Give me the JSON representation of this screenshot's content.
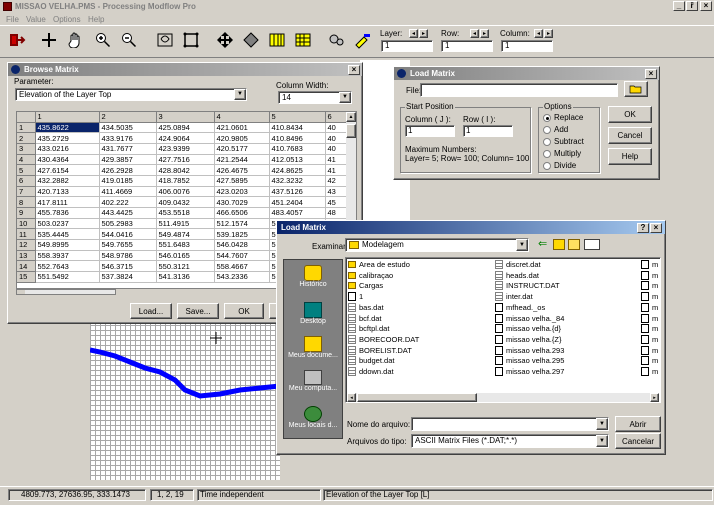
{
  "app": {
    "title": "MISSAO VELHA.PMS - Processing Modflow Pro",
    "menu": [
      "File",
      "Value",
      "Options",
      "Help"
    ],
    "window_buttons": [
      "_",
      "ř",
      "×"
    ]
  },
  "toolbar": {
    "layer_label": "Layer:",
    "row_label": "Row:",
    "column_label": "Column:",
    "layer_value": "1",
    "row_value": "1",
    "column_value": "1"
  },
  "browse": {
    "title": "Browse Matrix",
    "parameter_label": "Parameter:",
    "parameter_value": "Elevation of the Layer Top",
    "column_width_label": "Column Width:",
    "column_width_value": "14",
    "columns": [
      "",
      "1",
      "2",
      "3",
      "4",
      "5",
      "6"
    ],
    "rows": [
      [
        "1",
        "435.8622",
        "434.5035",
        "425.0894",
        "421.0601",
        "410.8434",
        "40"
      ],
      [
        "2",
        "435.2729",
        "433.9176",
        "424.9064",
        "420.9805",
        "410.8496",
        "40"
      ],
      [
        "3",
        "433.0216",
        "431.7677",
        "423.9399",
        "420.5177",
        "410.7683",
        "40"
      ],
      [
        "4",
        "430.4364",
        "429.3857",
        "427.7516",
        "421.2544",
        "412.0513",
        "41"
      ],
      [
        "5",
        "427.6154",
        "426.2928",
        "428.8042",
        "426.4675",
        "424.8625",
        "41"
      ],
      [
        "6",
        "432.2882",
        "419.0185",
        "418.7852",
        "427.5895",
        "432.3232",
        "42"
      ],
      [
        "7",
        "420.7133",
        "411.4669",
        "406.0076",
        "423.0203",
        "437.5126",
        "43"
      ],
      [
        "8",
        "417.8111",
        "402.222",
        "409.0432",
        "430.7029",
        "451.2404",
        "45"
      ],
      [
        "9",
        "455.7836",
        "443.4425",
        "453.5518",
        "466.6506",
        "483.4057",
        "48"
      ],
      [
        "10",
        "503.0237",
        "505.2983",
        "511.4915",
        "512.1574",
        "5",
        ""
      ],
      [
        "11",
        "535.4445",
        "544.0416",
        "549.4874",
        "539.1825",
        "5",
        ""
      ],
      [
        "12",
        "549.8995",
        "549.7655",
        "551.6483",
        "546.0428",
        "5",
        ""
      ],
      [
        "13",
        "558.3937",
        "548.9786",
        "546.0165",
        "544.7607",
        "5",
        ""
      ],
      [
        "14",
        "552.7643",
        "546.3715",
        "550.3121",
        "558.4667",
        "5",
        ""
      ],
      [
        "15",
        "551.5492",
        "537.3824",
        "541.3136",
        "543.2336",
        "5",
        ""
      ]
    ],
    "buttons": [
      "Load...",
      "Save...",
      "OK"
    ]
  },
  "load_small": {
    "title": "Load Matrix",
    "file_label": "File:",
    "start_position_label": "Start Position",
    "column_label": "Column ( J ):",
    "row_label": "Row ( I ):",
    "column_value": "1",
    "row_value": "1",
    "max_numbers_label": "Maximum Numbers:",
    "max_numbers_value": "Layer= 5; Row= 100; Column= 100",
    "options_label": "Options",
    "options": [
      "Replace",
      "Add",
      "Subtract",
      "Multiply",
      "Divide"
    ],
    "selected_option": "Replace",
    "buttons": [
      "OK",
      "Cancel",
      "Help"
    ]
  },
  "file_dialog": {
    "title": "Load Matrix",
    "title_buttons": [
      "?",
      "×"
    ],
    "look_in_label": "Examinar:",
    "look_in_value": "Modelagem",
    "places": [
      "Histórico",
      "Desktop",
      "Meus docume...",
      "Meu computa...",
      "Meus locais d..."
    ],
    "files_col1": [
      {
        "name": "Area de estudo",
        "icon": "folder-icon"
      },
      {
        "name": "calibraçao",
        "icon": "folder-icon"
      },
      {
        "name": "Cargas",
        "icon": "folder-icon"
      },
      {
        "name": "1",
        "icon": "doc-icon"
      },
      {
        "name": "bas.dat",
        "icon": "dat-icon"
      },
      {
        "name": "bcf.dat",
        "icon": "dat-icon"
      },
      {
        "name": "bcftpl.dat",
        "icon": "dat-icon"
      },
      {
        "name": "BORECOOR.DAT",
        "icon": "dat-icon"
      },
      {
        "name": "BORELIST.DAT",
        "icon": "dat-icon"
      },
      {
        "name": "budget.dat",
        "icon": "dat-icon"
      },
      {
        "name": "ddown.dat",
        "icon": "dat-icon"
      }
    ],
    "files_col2": [
      {
        "name": "discret.dat",
        "icon": "dat-icon"
      },
      {
        "name": "heads.dat",
        "icon": "dat-icon"
      },
      {
        "name": "INSTRUCT.DAT",
        "icon": "dat-icon"
      },
      {
        "name": "inter.dat",
        "icon": "dat-icon"
      },
      {
        "name": "mfhead._os",
        "icon": "doc-icon"
      },
      {
        "name": "missao velha._84",
        "icon": "doc-icon"
      },
      {
        "name": "missao velha.{d}",
        "icon": "doc-icon"
      },
      {
        "name": "missao velha.{Z}",
        "icon": "doc-icon"
      },
      {
        "name": "missao velha.293",
        "icon": "doc-icon"
      },
      {
        "name": "missao velha.295",
        "icon": "doc-icon"
      },
      {
        "name": "missao velha.297",
        "icon": "doc-icon"
      }
    ],
    "files_col3": [
      "m",
      "m",
      "m",
      "m",
      "m",
      "m",
      "m",
      "m",
      "m",
      "m",
      "m"
    ],
    "file_name_label": "Nome do arquivo:",
    "file_name_value": "",
    "file_type_label": "Arquivos do tipo:",
    "file_type_value": "ASCII Matrix Files (*.DAT;*.*)",
    "open_button": "Abrir",
    "cancel_button": "Cancelar"
  },
  "status": {
    "coords": "4809.773, 27636.95, 333.1473",
    "cell": "1, 2, 19",
    "time": "Time independent",
    "parameter": "Elevation of the Layer Top [L]"
  }
}
